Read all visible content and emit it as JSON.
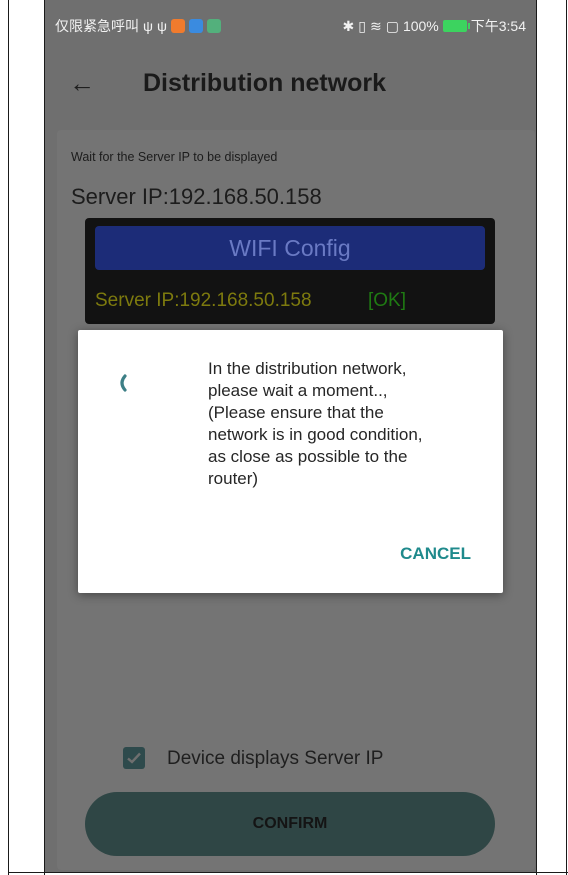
{
  "status_bar": {
    "left_text": "仅限紧急呼叫",
    "app_icons": [
      "usb-icon",
      "usb-icon",
      "video-app-icon",
      "blue-app-icon",
      "gallery-app-icon"
    ],
    "battery_percent": "100%",
    "time": "下午3:54"
  },
  "toolbar": {
    "title": "Distribution network"
  },
  "card": {
    "instruction": "Wait for the Server IP to be displayed",
    "server_ip_line": "Server IP:192.168.50.158",
    "lcd": {
      "header": "WIFI Config",
      "ip_line": "Server IP:192.168.50.158",
      "status": "[OK]"
    },
    "checkbox_label": "Device displays Server IP",
    "checkbox_checked": true,
    "confirm_label": "CONFIRM"
  },
  "dialog": {
    "lines": [
      "In the distribution network,",
      "please wait a moment..,",
      "(Please ensure that the",
      "network is in good condition,",
      "as close as possible to the",
      "router)"
    ],
    "cancel_label": "CANCEL"
  },
  "colors": {
    "accent_teal": "#1f8a8c",
    "lcd_header": "#1c2c78",
    "lcd_ip_text": "#7d7a0e",
    "lcd_ok_text": "#1f7a13",
    "battery": "#3cd35f"
  }
}
